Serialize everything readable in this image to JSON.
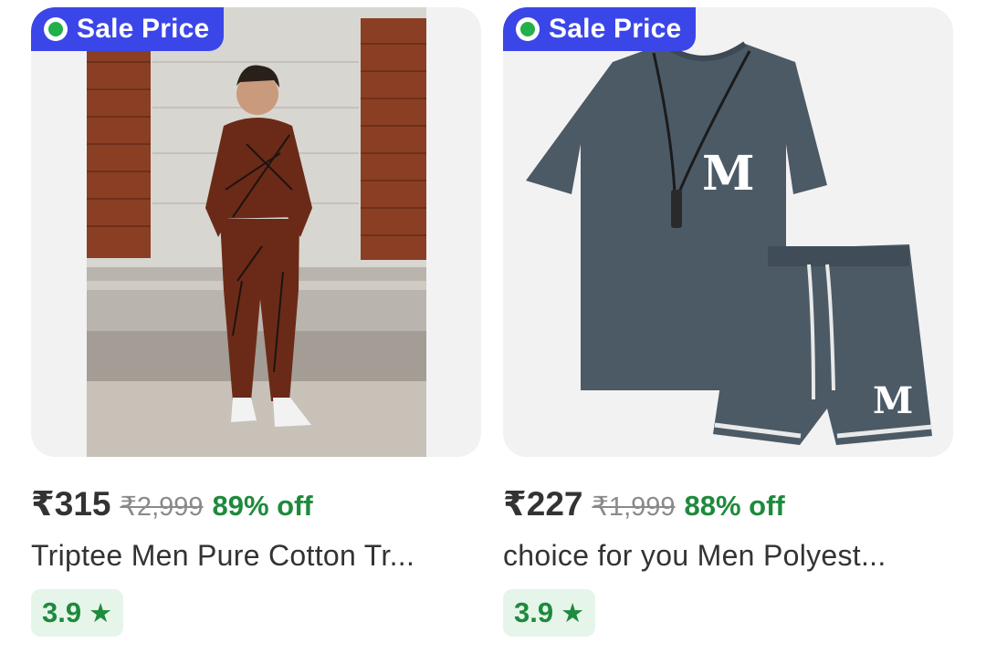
{
  "products": [
    {
      "badge": "Sale Price",
      "price": "₹315",
      "mrp": "₹2,999",
      "discount": "89% off",
      "title": "Triptee Men Pure Cotton Tr...",
      "rating": "3.9",
      "rating_icon": "star-icon"
    },
    {
      "badge": "Sale Price",
      "price": "₹227",
      "mrp": "₹1,999",
      "discount": "88% off",
      "title": "choice for you Men Polyest...",
      "rating": "3.9",
      "rating_icon": "star-icon"
    }
  ],
  "colors": {
    "badge_bg": "#3b46e8",
    "badge_dot": "#21b04b",
    "discount": "#1e8a3c",
    "rating_bg": "#e6f5ea"
  }
}
